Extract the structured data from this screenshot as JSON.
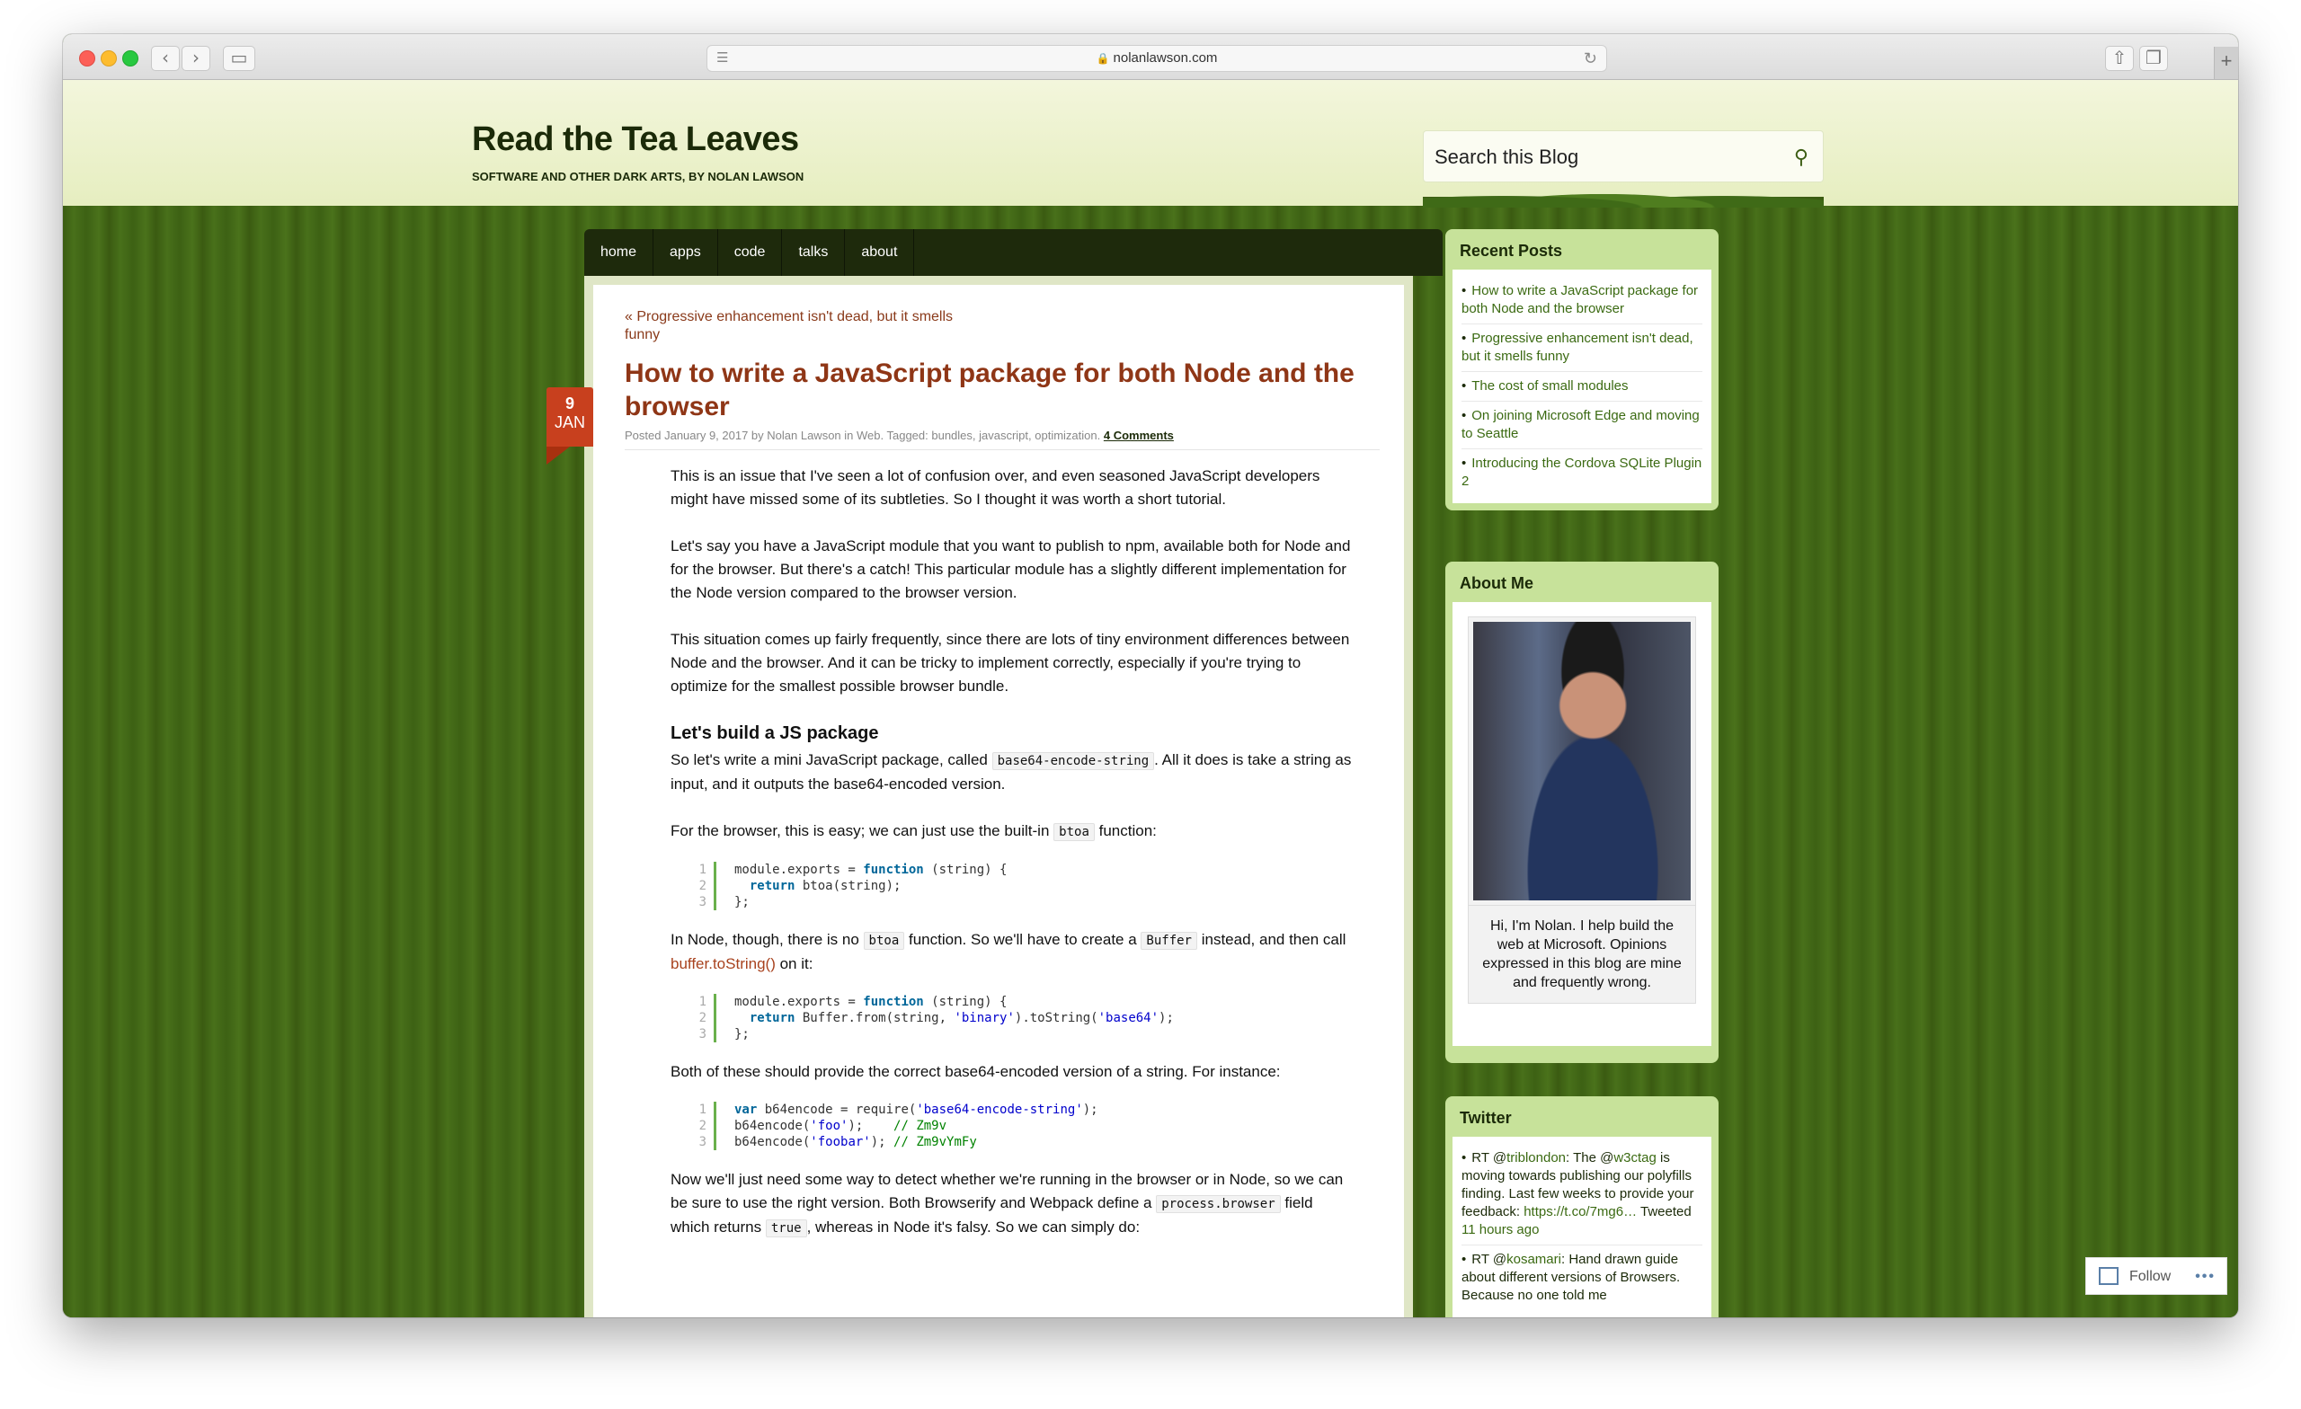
{
  "browser": {
    "url": "nolanlawson.com"
  },
  "site": {
    "title": "Read the Tea Leaves",
    "description": "SOFTWARE AND OTHER DARK ARTS, BY NOLAN LAWSON",
    "search_placeholder": "Search this Blog"
  },
  "nav": [
    "home",
    "apps",
    "code",
    "talks",
    "about"
  ],
  "post": {
    "prev_link": "« Progressive enhancement isn't dead, but it smells funny",
    "date_day": "9",
    "date_month": "JAN",
    "title": "How to write a JavaScript package for both Node and the browser",
    "meta_prefix": "Posted January 9, 2017 by Nolan Lawson in Web. Tagged: bundles, javascript, optimization.",
    "meta_comments": "4 Comments",
    "p1": "This is an issue that I've seen a lot of confusion over, and even seasoned JavaScript developers might have missed some of its subtleties. So I thought it was worth a short tutorial.",
    "p2": "Let's say you have a JavaScript module that you want to publish to npm, available both for Node and for the browser. But there's a catch! This particular module has a slightly different implementation for the Node version compared to the browser version.",
    "p3": "This situation comes up fairly frequently, since there are lots of tiny environment differences between Node and the browser. And it can be tricky to implement correctly, especially if you're trying to optimize for the smallest possible browser bundle.",
    "h3": "Let's build a JS package",
    "p4a": "So let's write a mini JavaScript package, called",
    "p4code": "base64-encode-string",
    "p4b": ". All it does is take a string as input, and it outputs the base64-encoded version.",
    "p5a": "For the browser, this is easy; we can just use the built-in",
    "p5code": "btoa",
    "p5b": "function:",
    "p6a": "In Node, though, there is no",
    "p6code1": "btoa",
    "p6b": "function. So we'll have to create a",
    "p6code2": "Buffer",
    "p6c": "instead, and then call",
    "p6link": "buffer.toString()",
    "p6d": "on it:",
    "p7": "Both of these should provide the correct base64-encoded version of a string. For instance:",
    "p8a": "Now we'll just need some way to detect whether we're running in the browser or in Node, so we can be sure to use the right version. Both Browserify and Webpack define a",
    "p8code1": "process.browser",
    "p8b": "field which returns",
    "p8code2": "true",
    "p8c": ", whereas in Node it's falsy. So we can simply do:"
  },
  "code1": {
    "gutter": "1\n2\n3",
    "l1a": "module.exports = ",
    "l1kw": "function",
    "l1b": " (string) {",
    "l2kw": "  return",
    "l2b": " btoa(string);",
    "l3": "};"
  },
  "code2": {
    "gutter": "1\n2\n3",
    "l1a": "module.exports = ",
    "l1kw": "function",
    "l1b": " (string) {",
    "l2kw": "  return",
    "l2b": " Buffer.from(string, ",
    "l2s1": "'binary'",
    "l2c": ").toString(",
    "l2s2": "'base64'",
    "l2d": ");",
    "l3": "};"
  },
  "code3": {
    "gutter": "1\n2\n3",
    "l1kw": "var",
    "l1a": " b64encode = require(",
    "l1s": "'base64-encode-string'",
    "l1b": ");",
    "l2a": "b64encode(",
    "l2s": "'foo'",
    "l2b": ");    ",
    "l2c": "// Zm9v",
    "l3a": "b64encode(",
    "l3s": "'foobar'",
    "l3b": "); ",
    "l3c": "// Zm9vYmFy"
  },
  "sidebar": {
    "recent_title": "Recent Posts",
    "recent": [
      "How to write a JavaScript package for both Node and the browser",
      "Progressive enhancement isn't dead, but it smells funny",
      "The cost of small modules",
      "On joining Microsoft Edge and moving to Seattle",
      "Introducing the Cordova SQLite Plugin 2"
    ],
    "about_title": "About Me",
    "about_caption": "Hi, I'm Nolan. I help build the web at Microsoft. Opinions expressed in this blog are mine and frequently wrong.",
    "twitter_title": "Twitter",
    "tweet1": {
      "prefix": "RT @",
      "user": "triblondon",
      "text1": ": The @",
      "mention": "w3ctag",
      "text2": " is moving towards publishing our polyfills finding. Last few weeks to provide your feedback:",
      "link": "https://t.co/7mg6…",
      "tweeted": " Tweeted",
      "ago": "11 hours ago"
    },
    "tweet2": {
      "prefix": "RT @",
      "user": "kosamari",
      "text": ": Hand drawn guide about different versions of Browsers. Because no one told me"
    }
  },
  "follow": {
    "label": "Follow",
    "dots": "•••"
  }
}
